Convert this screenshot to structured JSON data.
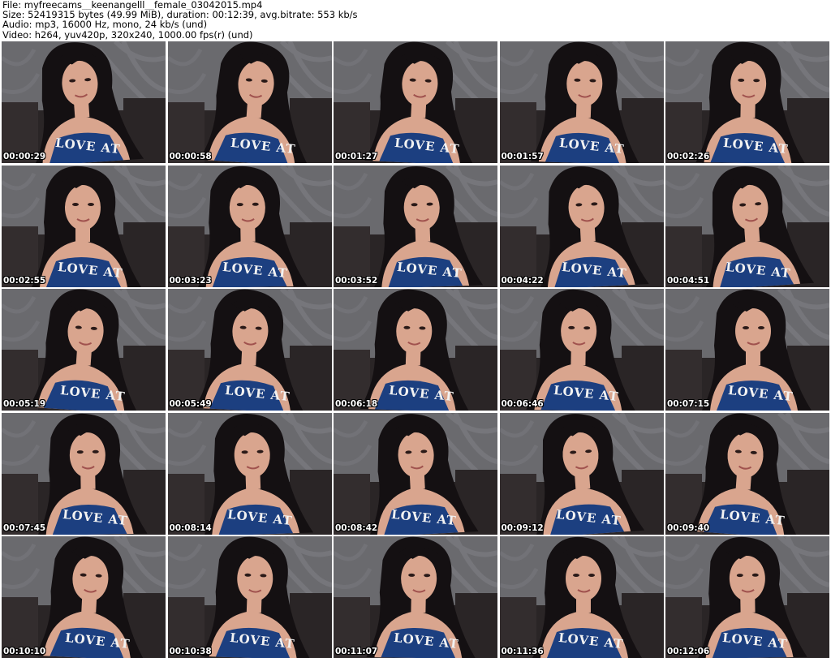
{
  "header": {
    "file_line": "File: myfreecams__keenangelll__female_03042015.mp4",
    "size_line": "Size: 52419315 bytes (49.99 MiB), duration: 00:12:39, avg.bitrate: 553 kb/s",
    "audio_line": "Audio: mp3, 16000 Hz, mono, 24 kb/s (und)",
    "video_line": "Video: h264, yuv420p, 320x240, 1000.00 fps(r) (und)"
  },
  "thumbnails": [
    {
      "timestamp": "00:00:29"
    },
    {
      "timestamp": "00:00:58"
    },
    {
      "timestamp": "00:01:27"
    },
    {
      "timestamp": "00:01:57"
    },
    {
      "timestamp": "00:02:26"
    },
    {
      "timestamp": "00:02:55"
    },
    {
      "timestamp": "00:03:23"
    },
    {
      "timestamp": "00:03:52"
    },
    {
      "timestamp": "00:04:22"
    },
    {
      "timestamp": "00:04:51"
    },
    {
      "timestamp": "00:05:19"
    },
    {
      "timestamp": "00:05:49"
    },
    {
      "timestamp": "00:06:18"
    },
    {
      "timestamp": "00:06:46"
    },
    {
      "timestamp": "00:07:15"
    },
    {
      "timestamp": "00:07:45"
    },
    {
      "timestamp": "00:08:14"
    },
    {
      "timestamp": "00:08:42"
    },
    {
      "timestamp": "00:09:12"
    },
    {
      "timestamp": "00:09:40"
    },
    {
      "timestamp": "00:10:10"
    },
    {
      "timestamp": "00:10:38"
    },
    {
      "timestamp": "00:11:07"
    },
    {
      "timestamp": "00:11:36"
    },
    {
      "timestamp": "00:12:06"
    }
  ],
  "shirt_text": "LOVE AT",
  "colors": {
    "wall": "#6a6a6e",
    "couch": "#2a2526",
    "hair": "#141012",
    "skin": "#d9a58e",
    "shirt": "#1c3f80",
    "timestamp": "#ffffff"
  }
}
